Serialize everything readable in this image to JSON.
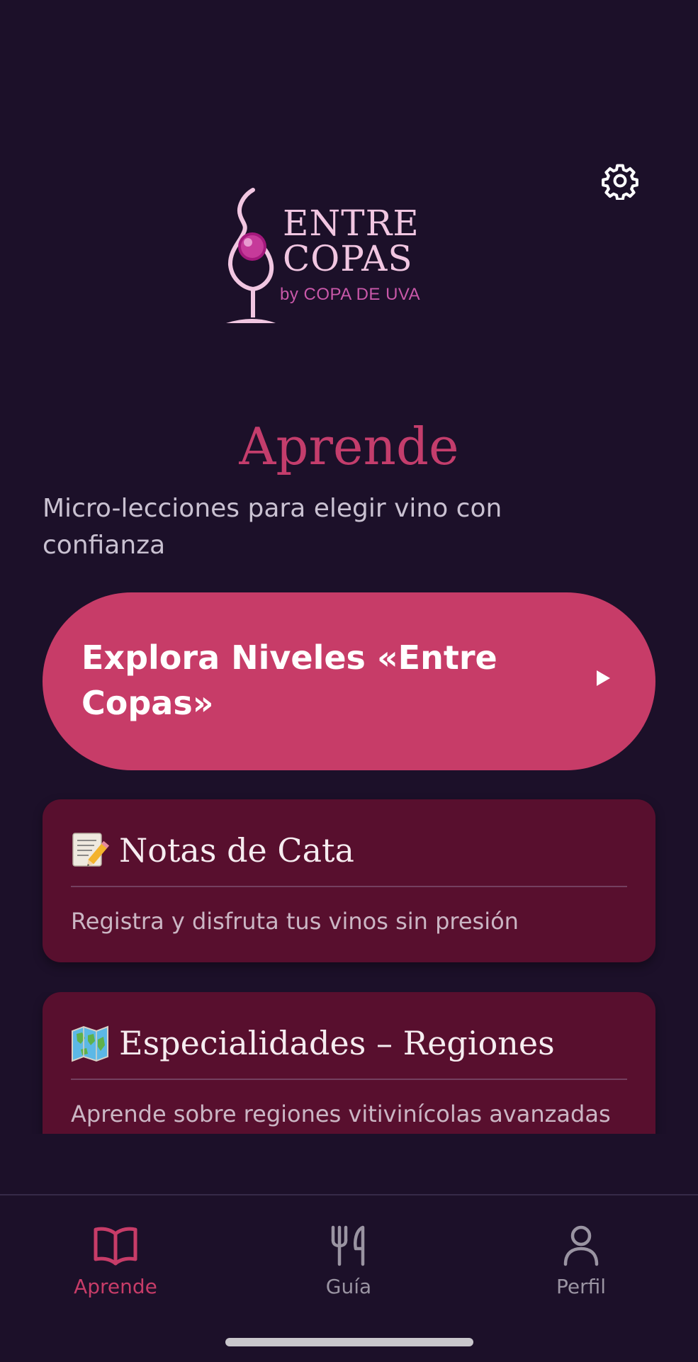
{
  "colors": {
    "background": "#1c1029",
    "accent": "#c73c68",
    "card": "#580f2e",
    "nav_inactive": "#9a94a2"
  },
  "header": {
    "settings_icon": "gear-icon",
    "logo": {
      "line1": "ENTRE",
      "line2": "COPAS",
      "byline": "by COPA DE UVA"
    }
  },
  "main": {
    "title": "Aprende",
    "subtitle": "Micro-lecciones para elegir vino con confianza",
    "cta": {
      "label": "Explora Niveles «Entre Copas»",
      "icon": "play-arrow-icon"
    },
    "cards": [
      {
        "emoji": "📝",
        "icon": "memo-pencil-icon",
        "title": "Notas de Cata",
        "description": "Registra y disfruta tus vinos sin presión"
      },
      {
        "emoji": "🗺️",
        "icon": "world-map-icon",
        "title": "Especialidades – Regiones",
        "description": "Aprende sobre regiones vitivinícolas avanzadas"
      }
    ]
  },
  "bottom_nav": {
    "items": [
      {
        "label": "Aprende",
        "icon": "open-book-icon",
        "active": true
      },
      {
        "label": "Guía",
        "icon": "fork-knife-icon",
        "active": false
      },
      {
        "label": "Perfil",
        "icon": "user-icon",
        "active": false
      }
    ]
  }
}
